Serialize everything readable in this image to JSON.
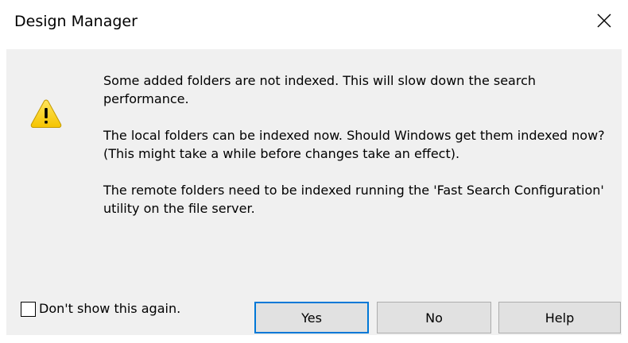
{
  "window": {
    "title": "Design Manager",
    "close_icon": "close-icon"
  },
  "message": {
    "icon": "warning-icon",
    "line1": "Some added folders are not indexed. This will slow down the search performance.",
    "line2": "The local folders can be indexed now. Should Windows get them indexed now?",
    "line3": "(This might take a while before changes take an effect).",
    "line4": "The remote folders need to be indexed running the 'Fast Search Configuration' utility on the file server."
  },
  "checkbox": {
    "label": "Don't show this again.",
    "checked": false
  },
  "buttons": {
    "yes": "Yes",
    "no": "No",
    "help": "Help"
  },
  "colors": {
    "content_bg": "#f0f0f0",
    "default_button_border": "#0078d7",
    "warning_fill": "#ffd200"
  }
}
